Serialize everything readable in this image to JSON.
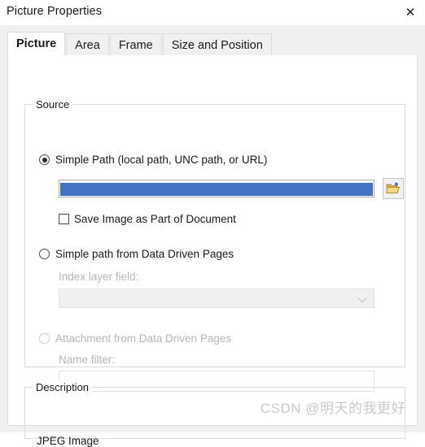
{
  "window": {
    "title": "Picture Properties",
    "close_label": "✕"
  },
  "tabs": [
    {
      "label": "Picture",
      "active": true
    },
    {
      "label": "Area",
      "active": false
    },
    {
      "label": "Frame",
      "active": false
    },
    {
      "label": "Size and Position",
      "active": false
    }
  ],
  "source": {
    "legend": "Source",
    "simple_path": {
      "label": "Simple Path (local path, UNC path, or URL)",
      "selected": true,
      "field_value": "",
      "field_selected_text_color": "#ffffff",
      "selection_color": "#4472c4",
      "browse_icon": "folder-open-icon"
    },
    "save_image": {
      "label": "Save Image as Part of Document",
      "checked": false
    },
    "data_driven_path": {
      "label": "Simple path from Data Driven Pages",
      "selected": false,
      "index_layer_field_label": "Index layer field:",
      "index_layer_field_value": "",
      "enabled": false
    },
    "attachment": {
      "label": "Attachment from Data Driven Pages",
      "selected": false,
      "enabled": false,
      "name_filter_label": "Name filter:",
      "name_filter_value": ""
    }
  },
  "description": {
    "legend": "Description",
    "text": "JPEG Image"
  },
  "watermark": {
    "text": "CSDN @明天的我更好"
  },
  "colors": {
    "selection_blue": "#4472c4",
    "dialog_background": "#f0f0f0",
    "page_background": "#ffffff",
    "disabled_text": "#b5b5b5"
  }
}
